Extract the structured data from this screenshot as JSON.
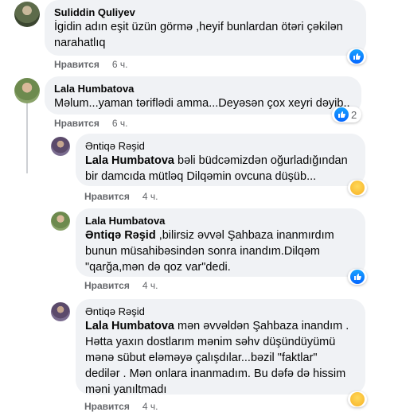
{
  "actions": {
    "like_label": "Нравится"
  },
  "comments": [
    {
      "author": "Suliddin Quliyev",
      "text_lines": [
        "İgidin adın eşit üzün görmə ,heyif bunlardan ötəri çəkilən",
        "narahatlıq"
      ],
      "time": "6 ч.",
      "reaction": {
        "icon": "like-icon",
        "count": ""
      }
    },
    {
      "author": "Lala Humbatova",
      "text_lines": [
        "Məlum...yaman təriflədi amma...Deyəsən çox xeyri dəyib.."
      ],
      "time": "6 ч.",
      "reaction": {
        "icon": "like-icon",
        "count": "2"
      }
    }
  ],
  "replies": [
    {
      "author": "Əntiqə Rəşid",
      "mention": "Lala Humbatova",
      "line1_rest": " bəli büdcəmizdən oğurladığından",
      "text_lines": [
        "bir damcıda mütləq Dilqəmin ovcuna düşüb..."
      ],
      "time": "4 ч.",
      "reaction": {
        "icon": "haha-icon"
      }
    },
    {
      "author": "Lala Humbatova",
      "mention": "Əntiqə Rəşid",
      "line1_rest": " ,bilirsiz əvvəl Şahbaza inanmırdım",
      "text_lines": [
        "bunun müsahibəsindən sonra inandım.Dilqəm",
        "\"qarğa,mən də qoz var\"dedi."
      ],
      "time": "4 ч.",
      "reaction": {
        "icon": "like-icon"
      }
    },
    {
      "author": "Əntiqə Rəşid",
      "mention": "Lala Humbatova",
      "line1_rest": " mən əvvəldən Şahbaza inandım .",
      "text_lines": [
        "Hətta yaxın dostlarım mənim səhv düşündüyümü",
        "mənə sübut eləməyə çalışdılar...bəzil \"faktlar\"",
        "dedilər . Mən onlara inanmadım. Bu dəfə də hissim",
        "məni yanıltmadı"
      ],
      "time": "4 ч.",
      "reaction": {
        "icon": "haha-icon"
      }
    }
  ]
}
